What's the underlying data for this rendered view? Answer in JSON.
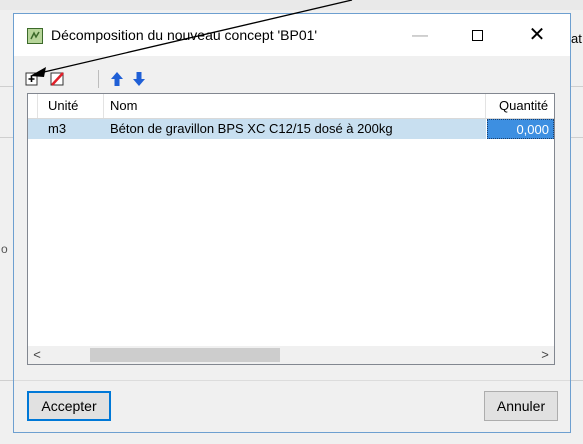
{
  "background": {
    "right_text": "at",
    "left_text": "o"
  },
  "dialog": {
    "title": "Décomposition du nouveau concept 'BP01'",
    "minimize_symbol": "—",
    "close_symbol": "✕"
  },
  "toolbar": {
    "icons": [
      "add-row-icon",
      "delete-row-icon",
      "move-up-icon",
      "move-down-icon"
    ],
    "colors": {
      "up_down": "#1f5fd6",
      "delete": "#e0202a"
    }
  },
  "grid": {
    "columns": [
      "Unité",
      "Nom",
      "Quantité"
    ],
    "rows": [
      {
        "unite": "m3",
        "nom": "Béton de gravillon BPS XC C12/15 dosé à 200kg",
        "quantite": "0,000"
      }
    ],
    "scroll_left": "<",
    "scroll_right": ">"
  },
  "buttons": {
    "accept": "Accepter",
    "cancel": "Annuler"
  },
  "colors": {
    "selected_row": "#c8dff0",
    "selected_cell": "#3d8fe1",
    "focus_border": "#0078d7"
  }
}
